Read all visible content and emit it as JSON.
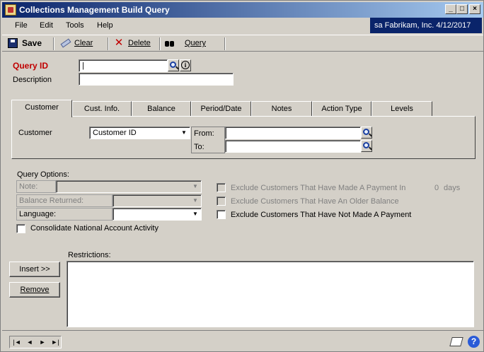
{
  "window": {
    "title": "Collections Management Build Query",
    "controls": {
      "minimize": "_",
      "maximize": "□",
      "close": "×"
    }
  },
  "menubar": {
    "items": [
      "File",
      "Edit",
      "Tools",
      "Help"
    ],
    "company": "sa  Fabrikam, Inc.  4/12/2017"
  },
  "toolbar": {
    "save_label": "Save",
    "clear_label": "Clear",
    "delete_label": "Delete",
    "query_label": "Query"
  },
  "form": {
    "query_id_label": "Query ID",
    "query_id_value": "|",
    "description_label": "Description",
    "description_value": ""
  },
  "tabs": [
    {
      "label": "Customer",
      "active": true
    },
    {
      "label": "Cust. Info.",
      "active": false
    },
    {
      "label": "Balance",
      "active": false
    },
    {
      "label": "Period/Date",
      "active": false
    },
    {
      "label": "Notes",
      "active": false
    },
    {
      "label": "Action Type",
      "active": false
    },
    {
      "label": "Levels",
      "active": false
    }
  ],
  "customer_tab": {
    "customer_label": "Customer",
    "customer_select_value": "Customer ID",
    "from_label": "From:",
    "from_value": "",
    "to_label": "To:",
    "to_value": ""
  },
  "query_options": {
    "heading": "Query Options:",
    "note_label": "Note:",
    "note_value": "",
    "balance_returned_label": "Balance Returned:",
    "balance_returned_value": "",
    "language_label": "Language:",
    "language_value": "",
    "consolidate_label": "Consolidate National Account Activity",
    "consolidate_checked": false,
    "exclude_payment_in_label": "Exclude Customers That Have Made A Payment In",
    "exclude_payment_in_days": "0",
    "days_label": "days",
    "exclude_older_balance_label": "Exclude Customers That Have An Older Balance",
    "exclude_not_made_payment_label": "Exclude Customers That Have Not Made A Payment"
  },
  "restrictions": {
    "label": "Restrictions:",
    "insert_button": "Insert >>",
    "remove_button": "Remove"
  },
  "statusbar": {
    "nav": [
      "|◄",
      "◄",
      "►",
      "►|"
    ],
    "help_glyph": "?"
  },
  "colors": {
    "title_gradient_start": "#0a246a",
    "title_gradient_end": "#a6caf0",
    "required_label": "#c00000",
    "window_bg": "#d4d0c8"
  }
}
